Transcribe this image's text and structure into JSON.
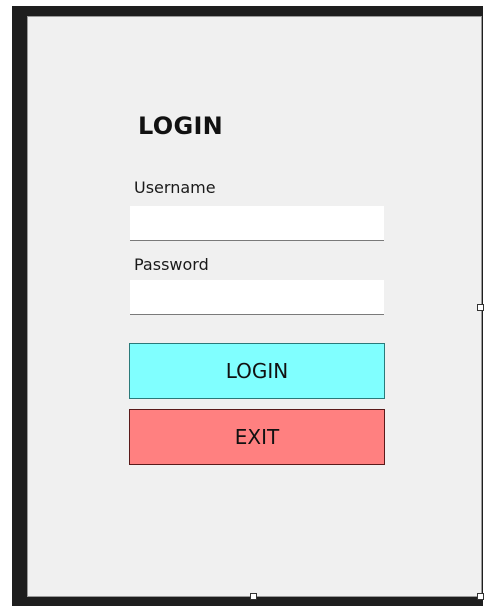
{
  "form": {
    "title": "LOGIN",
    "username": {
      "label": "Username",
      "value": ""
    },
    "password": {
      "label": "Password",
      "value": ""
    },
    "buttons": {
      "login_label": "LOGIN",
      "exit_label": "EXIT"
    }
  },
  "colors": {
    "form_background": "#f0f0f0",
    "frame_background": "#1e1e1e",
    "login_button": "#80ffff",
    "exit_button": "#ff8080"
  }
}
